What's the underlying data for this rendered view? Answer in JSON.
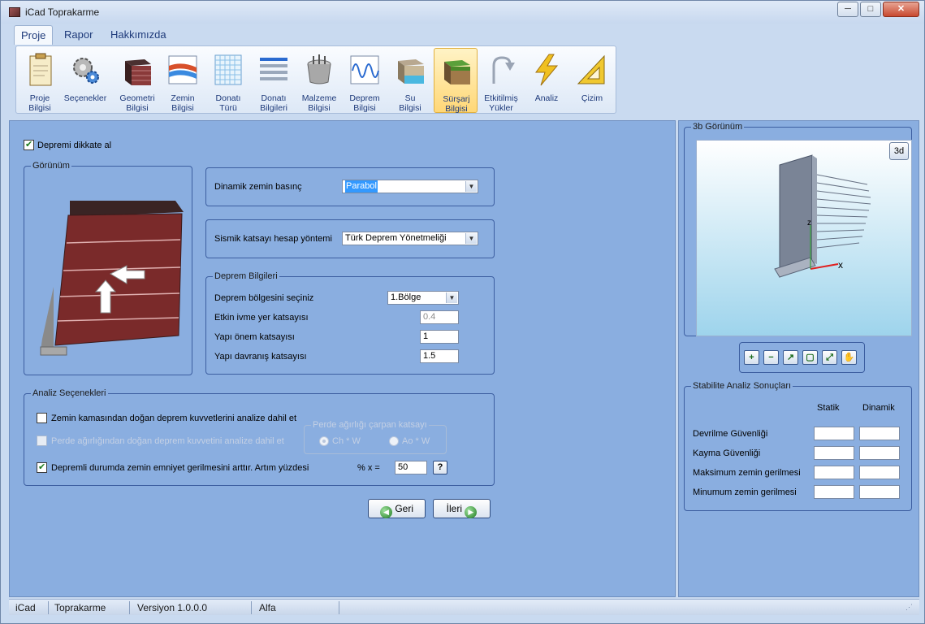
{
  "window": {
    "title": "iCad Toprakarme",
    "minimize": "─",
    "maximize": "□",
    "close": "✕"
  },
  "menu": {
    "tabs": [
      {
        "label": "Proje"
      },
      {
        "label": "Rapor"
      },
      {
        "label": "Hakkımızda"
      }
    ]
  },
  "ribbon": {
    "items": [
      {
        "line1": "Proje",
        "line2": "Bilgisi",
        "icon": "clipboard-icon"
      },
      {
        "line1": "Seçenekler",
        "line2": "",
        "icon": "gears-icon"
      },
      {
        "line1": "Geometri",
        "line2": "Bilgisi",
        "icon": "block-geometry-icon"
      },
      {
        "line1": "Zemin",
        "line2": "Bilgisi",
        "icon": "soil-layers-icon"
      },
      {
        "line1": "Donatı",
        "line2": "Türü",
        "icon": "mesh-grid-icon"
      },
      {
        "line1": "Donatı",
        "line2": "Bilgileri",
        "icon": "bars-icon"
      },
      {
        "line1": "Malzeme",
        "line2": "Bilgisi",
        "icon": "material-icon"
      },
      {
        "line1": "Deprem",
        "line2": "Bilgisi",
        "icon": "seismic-wave-icon"
      },
      {
        "line1": "Su",
        "line2": "Bilgisi",
        "icon": "water-block-icon"
      },
      {
        "line1": "Sürşarj",
        "line2": "Bilgisi",
        "icon": "surcharge-block-icon"
      },
      {
        "line1": "Etkitilmiş",
        "line2": "Yükler",
        "icon": "load-arrow-icon"
      },
      {
        "line1": "Analiz",
        "line2": "",
        "icon": "lightning-icon"
      },
      {
        "line1": "Çizim",
        "line2": "",
        "icon": "set-square-icon"
      }
    ]
  },
  "main": {
    "consider_quake": {
      "label": "Depremi dikkate al",
      "checked": true
    },
    "view_group": {
      "title": "Görünüm"
    },
    "dynamic_pressure": {
      "label": "Dinamik zemin basınç",
      "value": "Parabol"
    },
    "seismic_method": {
      "label": "Sismik katsayı hesap yöntemi",
      "value": "Türk Deprem Yönetmeliği"
    },
    "quake_info": {
      "title": "Deprem Bilgileri",
      "zone_label": "Deprem bölgesini seçiniz",
      "zone_value": "1.Bölge",
      "accel_label": "Etkin ivme yer katsayısı",
      "accel_value": "0.4",
      "importance_label": "Yapı önem katsayısı",
      "importance_value": "1",
      "behavior_label": "Yapı davranış katsayısı",
      "behavior_value": "1.5"
    },
    "analysis_options": {
      "title": "Analiz Seçenekleri",
      "opt1": "Zemin kamasından doğan deprem kuvvetlerini analize dahil et",
      "opt2": "Perde ağırlığından doğan deprem kuvvetini analize dahil et",
      "wall_weight_title": "Perde ağırlığı çarpan katsayı",
      "radio1": "Ch * W",
      "radio2": "Ao * W",
      "opt3": "Depremli durumda zemin emniyet gerilmesini  arttır. Artım yüzdesi",
      "percent_label": "% x =",
      "percent_value": "50",
      "help": "?"
    },
    "back_button": "Geri",
    "next_button": "İleri"
  },
  "right": {
    "view3d_title": "3b Görünüm",
    "btn3d": "3d",
    "axis_x": "x",
    "axis_z": "z",
    "toolbar": [
      {
        "icon": "zoom-in-icon",
        "glyph": "+"
      },
      {
        "icon": "zoom-out-icon",
        "glyph": "−"
      },
      {
        "icon": "zoom-window-icon",
        "glyph": "↗"
      },
      {
        "icon": "zoom-extents-icon",
        "glyph": "▢"
      },
      {
        "icon": "fit-icon",
        "glyph": "⤢"
      },
      {
        "icon": "pan-hand-icon",
        "glyph": "✋"
      }
    ],
    "stability": {
      "title": "Stabilite Analiz Sonuçları",
      "col_static": "Statik",
      "col_dynamic": "Dinamik",
      "rows": [
        "Devrilme Güvenliği",
        "Kayma Güvenliği",
        "Maksimum zemin gerilmesi",
        "Minumum zemin gerilmesi"
      ]
    }
  },
  "status": {
    "app": "iCad",
    "module": "Toprakarme",
    "version": "Versiyon 1.0.0.0",
    "stage": "Alfa"
  },
  "colors": {
    "panel": "#8aaee0",
    "accent": "#1e3a7a",
    "brick": "#7a2a2a"
  }
}
